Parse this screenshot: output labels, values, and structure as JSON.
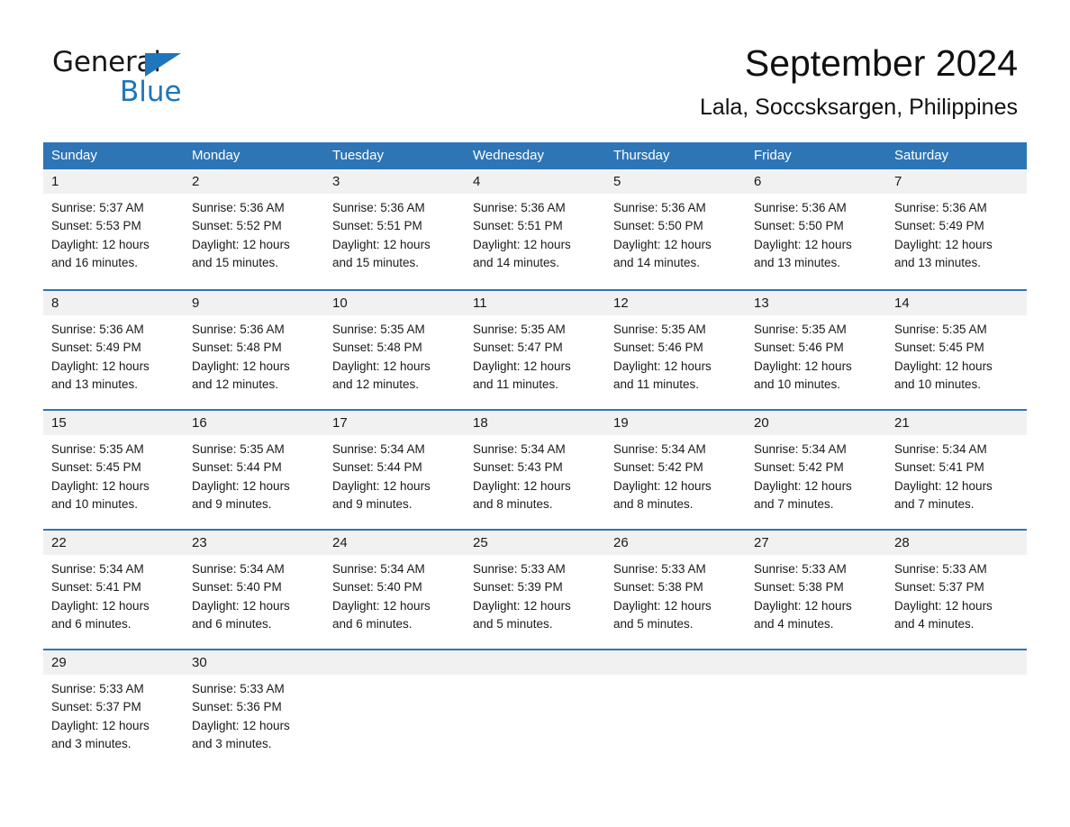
{
  "brand": {
    "name_part1": "General",
    "name_part2": "Blue",
    "accent_color": "#1f76bc"
  },
  "header": {
    "title": "September 2024",
    "subtitle": "Lala, Soccsksargen, Philippines"
  },
  "theme": {
    "header_row_color": "#2e75b6",
    "day_band_color": "#f1f1f1",
    "row_divider_color": "#2e75b6"
  },
  "weekdays": [
    "Sunday",
    "Monday",
    "Tuesday",
    "Wednesday",
    "Thursday",
    "Friday",
    "Saturday"
  ],
  "weeks": [
    [
      {
        "day": "1",
        "sunrise": "Sunrise: 5:37 AM",
        "sunset": "Sunset: 5:53 PM",
        "daylight_line1": "Daylight: 12 hours",
        "daylight_line2": "and 16 minutes."
      },
      {
        "day": "2",
        "sunrise": "Sunrise: 5:36 AM",
        "sunset": "Sunset: 5:52 PM",
        "daylight_line1": "Daylight: 12 hours",
        "daylight_line2": "and 15 minutes."
      },
      {
        "day": "3",
        "sunrise": "Sunrise: 5:36 AM",
        "sunset": "Sunset: 5:51 PM",
        "daylight_line1": "Daylight: 12 hours",
        "daylight_line2": "and 15 minutes."
      },
      {
        "day": "4",
        "sunrise": "Sunrise: 5:36 AM",
        "sunset": "Sunset: 5:51 PM",
        "daylight_line1": "Daylight: 12 hours",
        "daylight_line2": "and 14 minutes."
      },
      {
        "day": "5",
        "sunrise": "Sunrise: 5:36 AM",
        "sunset": "Sunset: 5:50 PM",
        "daylight_line1": "Daylight: 12 hours",
        "daylight_line2": "and 14 minutes."
      },
      {
        "day": "6",
        "sunrise": "Sunrise: 5:36 AM",
        "sunset": "Sunset: 5:50 PM",
        "daylight_line1": "Daylight: 12 hours",
        "daylight_line2": "and 13 minutes."
      },
      {
        "day": "7",
        "sunrise": "Sunrise: 5:36 AM",
        "sunset": "Sunset: 5:49 PM",
        "daylight_line1": "Daylight: 12 hours",
        "daylight_line2": "and 13 minutes."
      }
    ],
    [
      {
        "day": "8",
        "sunrise": "Sunrise: 5:36 AM",
        "sunset": "Sunset: 5:49 PM",
        "daylight_line1": "Daylight: 12 hours",
        "daylight_line2": "and 13 minutes."
      },
      {
        "day": "9",
        "sunrise": "Sunrise: 5:36 AM",
        "sunset": "Sunset: 5:48 PM",
        "daylight_line1": "Daylight: 12 hours",
        "daylight_line2": "and 12 minutes."
      },
      {
        "day": "10",
        "sunrise": "Sunrise: 5:35 AM",
        "sunset": "Sunset: 5:48 PM",
        "daylight_line1": "Daylight: 12 hours",
        "daylight_line2": "and 12 minutes."
      },
      {
        "day": "11",
        "sunrise": "Sunrise: 5:35 AM",
        "sunset": "Sunset: 5:47 PM",
        "daylight_line1": "Daylight: 12 hours",
        "daylight_line2": "and 11 minutes."
      },
      {
        "day": "12",
        "sunrise": "Sunrise: 5:35 AM",
        "sunset": "Sunset: 5:46 PM",
        "daylight_line1": "Daylight: 12 hours",
        "daylight_line2": "and 11 minutes."
      },
      {
        "day": "13",
        "sunrise": "Sunrise: 5:35 AM",
        "sunset": "Sunset: 5:46 PM",
        "daylight_line1": "Daylight: 12 hours",
        "daylight_line2": "and 10 minutes."
      },
      {
        "day": "14",
        "sunrise": "Sunrise: 5:35 AM",
        "sunset": "Sunset: 5:45 PM",
        "daylight_line1": "Daylight: 12 hours",
        "daylight_line2": "and 10 minutes."
      }
    ],
    [
      {
        "day": "15",
        "sunrise": "Sunrise: 5:35 AM",
        "sunset": "Sunset: 5:45 PM",
        "daylight_line1": "Daylight: 12 hours",
        "daylight_line2": "and 10 minutes."
      },
      {
        "day": "16",
        "sunrise": "Sunrise: 5:35 AM",
        "sunset": "Sunset: 5:44 PM",
        "daylight_line1": "Daylight: 12 hours",
        "daylight_line2": "and 9 minutes."
      },
      {
        "day": "17",
        "sunrise": "Sunrise: 5:34 AM",
        "sunset": "Sunset: 5:44 PM",
        "daylight_line1": "Daylight: 12 hours",
        "daylight_line2": "and 9 minutes."
      },
      {
        "day": "18",
        "sunrise": "Sunrise: 5:34 AM",
        "sunset": "Sunset: 5:43 PM",
        "daylight_line1": "Daylight: 12 hours",
        "daylight_line2": "and 8 minutes."
      },
      {
        "day": "19",
        "sunrise": "Sunrise: 5:34 AM",
        "sunset": "Sunset: 5:42 PM",
        "daylight_line1": "Daylight: 12 hours",
        "daylight_line2": "and 8 minutes."
      },
      {
        "day": "20",
        "sunrise": "Sunrise: 5:34 AM",
        "sunset": "Sunset: 5:42 PM",
        "daylight_line1": "Daylight: 12 hours",
        "daylight_line2": "and 7 minutes."
      },
      {
        "day": "21",
        "sunrise": "Sunrise: 5:34 AM",
        "sunset": "Sunset: 5:41 PM",
        "daylight_line1": "Daylight: 12 hours",
        "daylight_line2": "and 7 minutes."
      }
    ],
    [
      {
        "day": "22",
        "sunrise": "Sunrise: 5:34 AM",
        "sunset": "Sunset: 5:41 PM",
        "daylight_line1": "Daylight: 12 hours",
        "daylight_line2": "and 6 minutes."
      },
      {
        "day": "23",
        "sunrise": "Sunrise: 5:34 AM",
        "sunset": "Sunset: 5:40 PM",
        "daylight_line1": "Daylight: 12 hours",
        "daylight_line2": "and 6 minutes."
      },
      {
        "day": "24",
        "sunrise": "Sunrise: 5:34 AM",
        "sunset": "Sunset: 5:40 PM",
        "daylight_line1": "Daylight: 12 hours",
        "daylight_line2": "and 6 minutes."
      },
      {
        "day": "25",
        "sunrise": "Sunrise: 5:33 AM",
        "sunset": "Sunset: 5:39 PM",
        "daylight_line1": "Daylight: 12 hours",
        "daylight_line2": "and 5 minutes."
      },
      {
        "day": "26",
        "sunrise": "Sunrise: 5:33 AM",
        "sunset": "Sunset: 5:38 PM",
        "daylight_line1": "Daylight: 12 hours",
        "daylight_line2": "and 5 minutes."
      },
      {
        "day": "27",
        "sunrise": "Sunrise: 5:33 AM",
        "sunset": "Sunset: 5:38 PM",
        "daylight_line1": "Daylight: 12 hours",
        "daylight_line2": "and 4 minutes."
      },
      {
        "day": "28",
        "sunrise": "Sunrise: 5:33 AM",
        "sunset": "Sunset: 5:37 PM",
        "daylight_line1": "Daylight: 12 hours",
        "daylight_line2": "and 4 minutes."
      }
    ],
    [
      {
        "day": "29",
        "sunrise": "Sunrise: 5:33 AM",
        "sunset": "Sunset: 5:37 PM",
        "daylight_line1": "Daylight: 12 hours",
        "daylight_line2": "and 3 minutes."
      },
      {
        "day": "30",
        "sunrise": "Sunrise: 5:33 AM",
        "sunset": "Sunset: 5:36 PM",
        "daylight_line1": "Daylight: 12 hours",
        "daylight_line2": "and 3 minutes."
      },
      {
        "day": "",
        "sunrise": "",
        "sunset": "",
        "daylight_line1": "",
        "daylight_line2": ""
      },
      {
        "day": "",
        "sunrise": "",
        "sunset": "",
        "daylight_line1": "",
        "daylight_line2": ""
      },
      {
        "day": "",
        "sunrise": "",
        "sunset": "",
        "daylight_line1": "",
        "daylight_line2": ""
      },
      {
        "day": "",
        "sunrise": "",
        "sunset": "",
        "daylight_line1": "",
        "daylight_line2": ""
      },
      {
        "day": "",
        "sunrise": "",
        "sunset": "",
        "daylight_line1": "",
        "daylight_line2": ""
      }
    ]
  ]
}
